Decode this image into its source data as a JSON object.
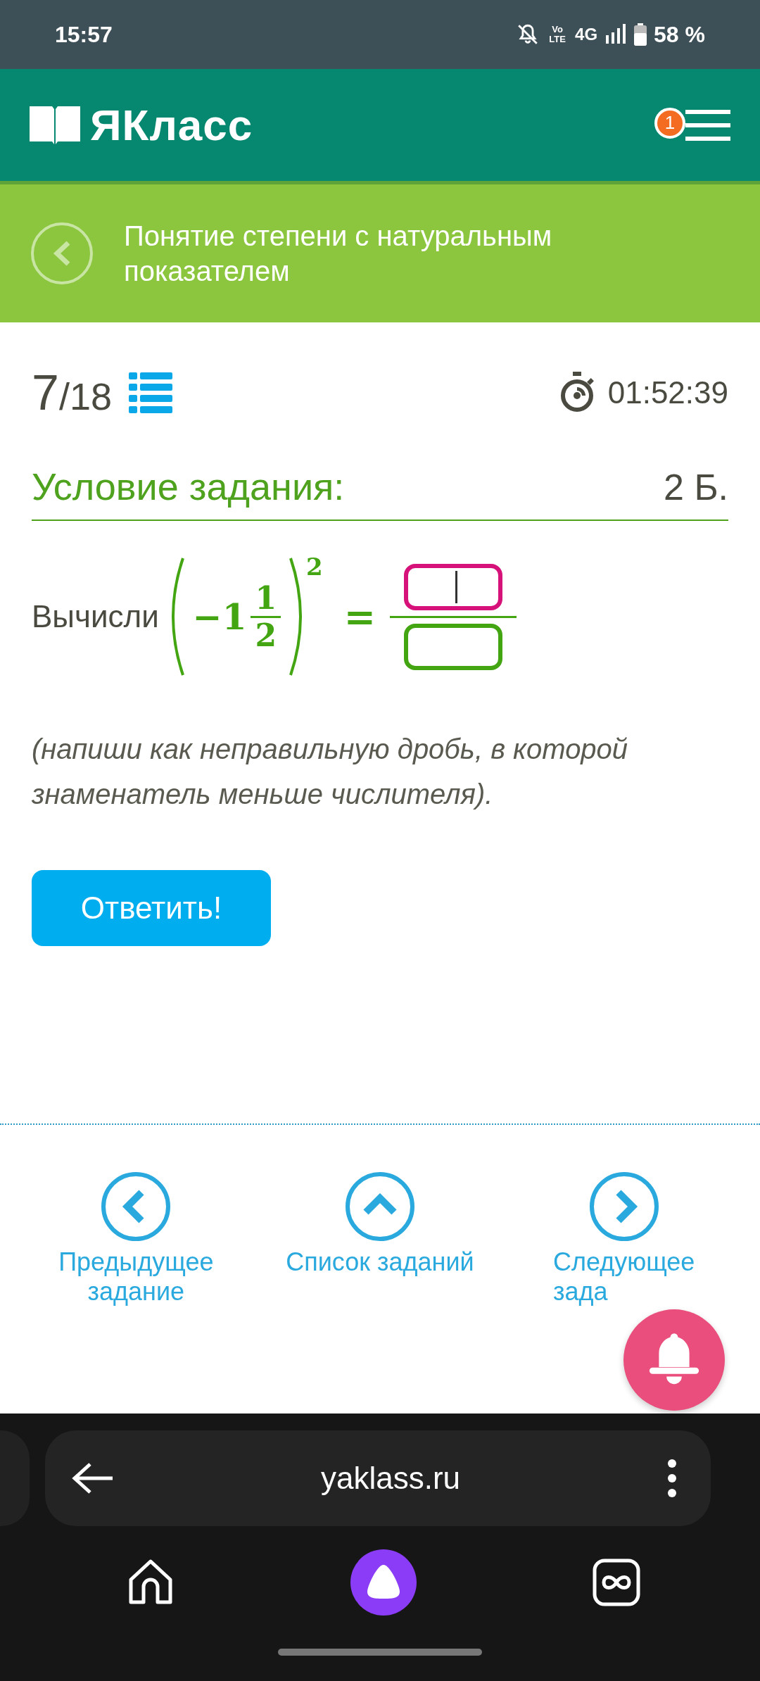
{
  "status_bar": {
    "time": "15:57",
    "volte": "Vo LTE",
    "network": "4G",
    "battery": "58 %"
  },
  "header": {
    "logo": "ЯКласс",
    "menu_badge": "1"
  },
  "topic": {
    "title": "Понятие степени с натуральным показателем"
  },
  "progress": {
    "current": "7",
    "total": "/18",
    "timer": "01:52:39"
  },
  "task": {
    "heading": "Условие задания:",
    "points": "2 Б.",
    "prompt": "Вычисли",
    "expression": {
      "whole": "−1",
      "numerator": "1",
      "denominator": "2",
      "exponent": "2",
      "equals": "="
    },
    "answer_fields": [
      {
        "focused": true
      },
      {
        "focused": false
      }
    ],
    "hint": "(напиши как неправильную дробь, в которой знаменатель меньше числителя).",
    "submit": "Ответить!"
  },
  "nav": [
    {
      "kind": "prev",
      "label": "Предыдущее задание"
    },
    {
      "kind": "list",
      "label": "Список заданий"
    },
    {
      "kind": "next",
      "label": "Следующее зада"
    }
  ],
  "browser": {
    "url": "yaklass.ru"
  }
}
